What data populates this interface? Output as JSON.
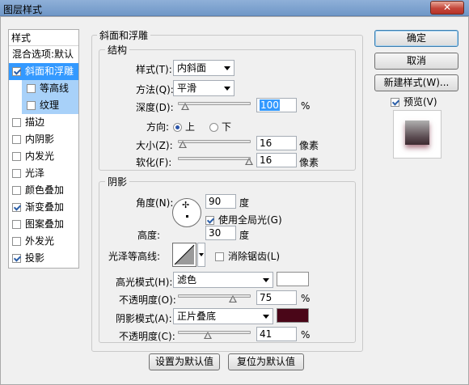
{
  "window": {
    "title": "图层样式",
    "close_label": "✕"
  },
  "sidebar": {
    "header": "样式",
    "items": [
      {
        "label": "混合选项:默认",
        "checkbox": false,
        "checked": false,
        "selected": false,
        "sub": false
      },
      {
        "label": "斜面和浮雕",
        "checkbox": true,
        "checked": true,
        "selected": true,
        "sub": false
      },
      {
        "label": "等高线",
        "checkbox": true,
        "checked": false,
        "selected": false,
        "sub": true
      },
      {
        "label": "纹理",
        "checkbox": true,
        "checked": false,
        "selected": false,
        "sub": true
      },
      {
        "label": "描边",
        "checkbox": true,
        "checked": false,
        "selected": false,
        "sub": false
      },
      {
        "label": "内阴影",
        "checkbox": true,
        "checked": false,
        "selected": false,
        "sub": false
      },
      {
        "label": "内发光",
        "checkbox": true,
        "checked": false,
        "selected": false,
        "sub": false
      },
      {
        "label": "光泽",
        "checkbox": true,
        "checked": false,
        "selected": false,
        "sub": false
      },
      {
        "label": "颜色叠加",
        "checkbox": true,
        "checked": false,
        "selected": false,
        "sub": false
      },
      {
        "label": "渐变叠加",
        "checkbox": true,
        "checked": true,
        "selected": false,
        "sub": false
      },
      {
        "label": "图案叠加",
        "checkbox": true,
        "checked": false,
        "selected": false,
        "sub": false
      },
      {
        "label": "外发光",
        "checkbox": true,
        "checked": false,
        "selected": false,
        "sub": false
      },
      {
        "label": "投影",
        "checkbox": true,
        "checked": true,
        "selected": false,
        "sub": false
      }
    ]
  },
  "bevel": {
    "group_title": "斜面和浮雕",
    "structure": {
      "title": "结构",
      "style_label": "样式(T):",
      "style_value": "内斜面",
      "technique_label": "方法(Q):",
      "technique_value": "平滑",
      "depth_label": "深度(D):",
      "depth_value": "100",
      "depth_unit": "%",
      "depth_level": 0.1,
      "direction_label": "方向:",
      "direction_up": "上",
      "direction_down": "下",
      "size_label": "大小(Z):",
      "size_value": "16",
      "size_unit": "像素",
      "size_level": 0.07,
      "soften_label": "软化(F):",
      "soften_value": "16",
      "soften_unit": "像素",
      "soften_level": 0.98
    },
    "shading": {
      "title": "阴影",
      "angle_label": "角度(N):",
      "angle_value": "90",
      "angle_unit": "度",
      "global_light_label": "使用全局光(G)",
      "global_light_checked": true,
      "altitude_label": "高度:",
      "altitude_value": "30",
      "altitude_unit": "度",
      "gloss_contour_label": "光泽等高线:",
      "antialias_label": "消除锯齿(L)",
      "antialias_checked": false,
      "highlight_mode_label": "高光模式(H):",
      "highlight_mode_value": "滤色",
      "highlight_color": "#ffffff",
      "highlight_opacity_label": "不透明度(O):",
      "highlight_opacity_value": "75",
      "highlight_opacity_unit": "%",
      "highlight_opacity_level": 0.75,
      "shadow_mode_label": "阴影模式(A):",
      "shadow_mode_value": "正片叠底",
      "shadow_color": "#4a0618",
      "shadow_opacity_label": "不透明度(C):",
      "shadow_opacity_value": "41",
      "shadow_opacity_unit": "%",
      "shadow_opacity_level": 0.41
    },
    "make_default_label": "设置为默认值",
    "reset_default_label": "复位为默认值"
  },
  "actions": {
    "ok_label": "确定",
    "cancel_label": "取消",
    "new_style_label": "新建样式(W)...",
    "preview_label": "预览(V)",
    "preview_checked": true
  },
  "colors": {
    "selection": "#3399ff",
    "sub_selection": "#a8d1f9",
    "title_bar": "#7ea3d0"
  }
}
